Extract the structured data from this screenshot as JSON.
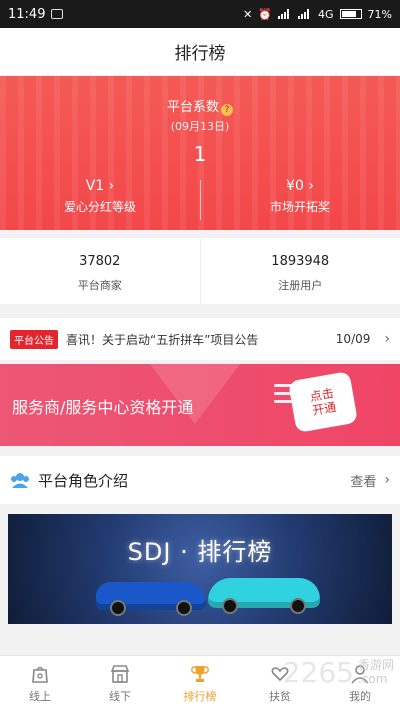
{
  "status_bar": {
    "time": "11:49",
    "network": "4G",
    "battery": "71%"
  },
  "header": {
    "title": "排行榜"
  },
  "hero": {
    "coef_label": "平台系数",
    "help_icon": "?",
    "date": "(09月13日)",
    "value": "1",
    "left_value": "V1",
    "left_label": "爱心分红等级",
    "right_value": "¥0",
    "right_label": "市场开拓奖"
  },
  "stats": {
    "merchants_value": "37802",
    "merchants_label": "平台商家",
    "users_value": "1893948",
    "users_label": "注册用户"
  },
  "notice": {
    "tag": "平台公告",
    "text": "喜讯！关于启动“五折拼车”项目公告",
    "date": "10/09"
  },
  "service_banner": {
    "title": "服务商/服务中心资格开通",
    "badge_line1": "点击",
    "badge_line2": "开通"
  },
  "section": {
    "title": "平台角色介绍",
    "more": "查看"
  },
  "promo": {
    "title": "SDJ · 排行榜"
  },
  "tabbar": {
    "items": [
      {
        "label": "线上",
        "icon": "bag-icon"
      },
      {
        "label": "线下",
        "icon": "store-icon"
      },
      {
        "label": "排行榜",
        "icon": "trophy-icon"
      },
      {
        "label": "扶贫",
        "icon": "heart-hand-icon"
      },
      {
        "label": "我的",
        "icon": "user-icon"
      }
    ]
  },
  "watermark": {
    "brand": "2265",
    "line1": "香游网",
    "line2": ".com"
  },
  "colors": {
    "hero_red": "#f3474a",
    "banner_pink": "#f04566",
    "tab_active": "#f0a12d",
    "notice_tag": "#e3262e"
  }
}
